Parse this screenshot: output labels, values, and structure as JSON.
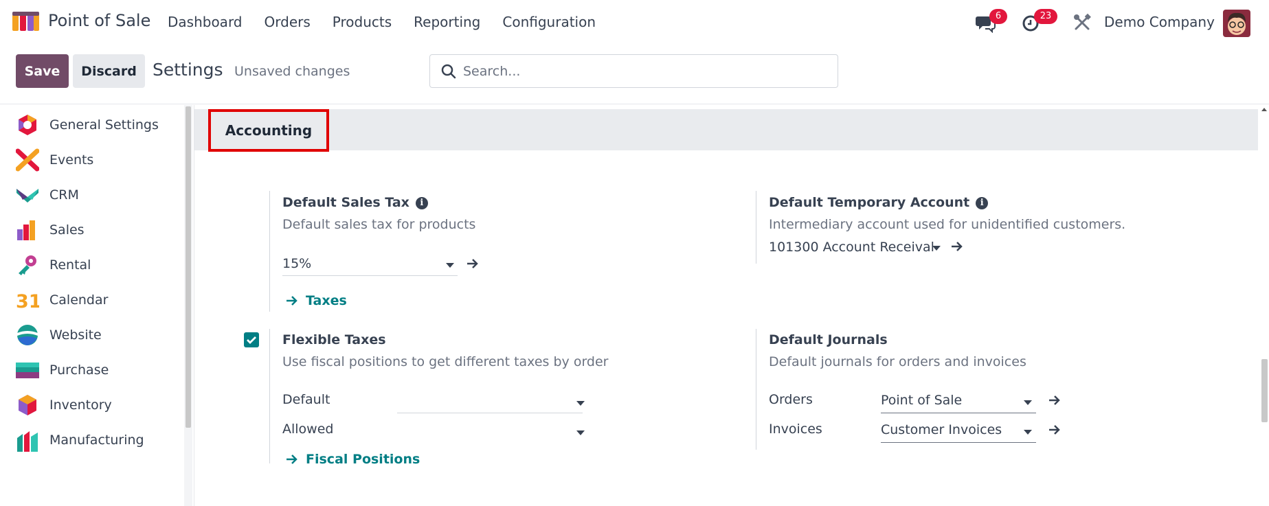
{
  "navbar": {
    "app_name": "Point of Sale",
    "menu": [
      "Dashboard",
      "Orders",
      "Products",
      "Reporting",
      "Configuration"
    ],
    "chat_count": "6",
    "activity_count": "23",
    "company": "Demo Company"
  },
  "control": {
    "save_label": "Save",
    "discard_label": "Discard",
    "title": "Settings",
    "status": "Unsaved changes",
    "search_placeholder": "Search..."
  },
  "sidebar": {
    "items": [
      {
        "label": "General Settings",
        "icon": "general-settings-icon"
      },
      {
        "label": "Events",
        "icon": "events-icon"
      },
      {
        "label": "CRM",
        "icon": "crm-icon"
      },
      {
        "label": "Sales",
        "icon": "sales-icon"
      },
      {
        "label": "Rental",
        "icon": "rental-icon"
      },
      {
        "label": "Calendar",
        "icon": "calendar-icon"
      },
      {
        "label": "Website",
        "icon": "website-icon"
      },
      {
        "label": "Purchase",
        "icon": "purchase-icon"
      },
      {
        "label": "Inventory",
        "icon": "inventory-icon"
      },
      {
        "label": "Manufacturing",
        "icon": "manufacturing-icon"
      }
    ],
    "calendar_number": "31"
  },
  "section": {
    "title": "Accounting"
  },
  "settings": {
    "sales_tax": {
      "title": "Default Sales Tax",
      "description": "Default sales tax for products",
      "value": "15%",
      "link": "Taxes"
    },
    "temp_account": {
      "title": "Default Temporary Account",
      "description": "Intermediary account used for unidentified customers.",
      "value": "101300 Account Receival"
    },
    "flexible_taxes": {
      "title": "Flexible Taxes",
      "description": "Use fiscal positions to get different taxes by order",
      "checked": true,
      "default_label": "Default",
      "allowed_label": "Allowed",
      "link": "Fiscal Positions"
    },
    "journals": {
      "title": "Default Journals",
      "description": "Default journals for orders and invoices",
      "orders_label": "Orders",
      "orders_value": "Point of Sale",
      "invoices_label": "Invoices",
      "invoices_value": "Customer Invoices"
    }
  },
  "colors": {
    "brand": "#714b67",
    "teal": "#017e84",
    "badge": "#e2173d",
    "highlight": "#e00000"
  }
}
